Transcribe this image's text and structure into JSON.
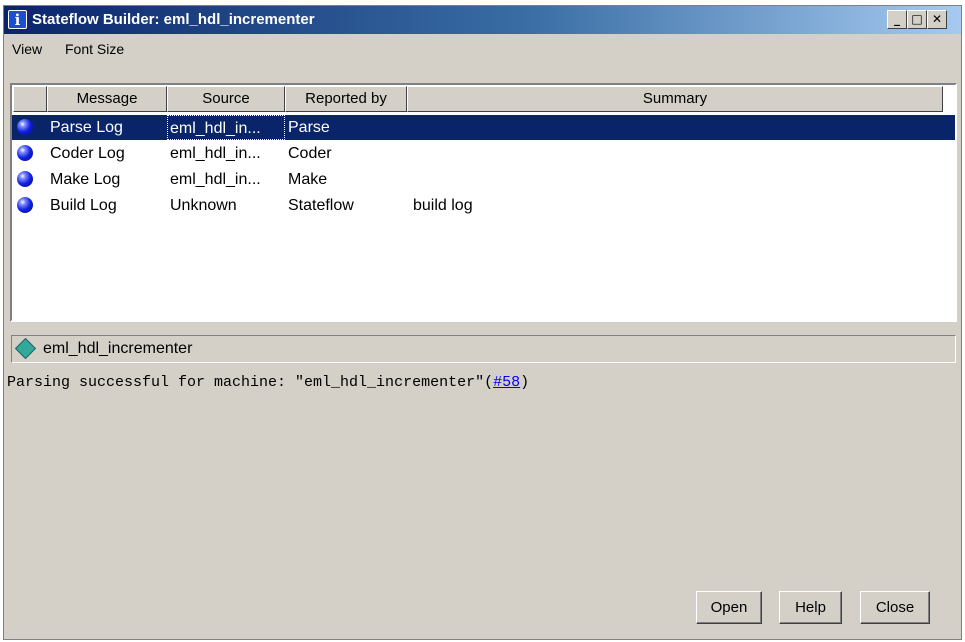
{
  "window": {
    "title": "Stateflow Builder: eml_hdl_incrementer",
    "controls": {
      "minimize": "_",
      "maximize": "□",
      "close": "✕"
    }
  },
  "menubar": {
    "items": [
      "View",
      "Font Size"
    ]
  },
  "grid": {
    "columns": [
      "Message",
      "Source",
      "Reported by",
      "Summary"
    ],
    "rows": [
      {
        "icon": "blue-ball-icon",
        "message": "Parse Log",
        "source": "eml_hdl_in...",
        "reported_by": "Parse",
        "summary": "",
        "selected": true
      },
      {
        "icon": "blue-ball-icon",
        "message": "Coder Log",
        "source": "eml_hdl_in...",
        "reported_by": "Coder",
        "summary": "",
        "selected": false
      },
      {
        "icon": "blue-ball-icon",
        "message": "Make Log",
        "source": "eml_hdl_in...",
        "reported_by": "Make",
        "summary": "",
        "selected": false
      },
      {
        "icon": "blue-ball-icon",
        "message": "Build Log",
        "source": "Unknown",
        "reported_by": "Stateflow",
        "summary": "build log",
        "selected": false
      }
    ]
  },
  "path_bar": {
    "icon": "stateflow-diamond-icon",
    "text": "eml_hdl_incrementer"
  },
  "log": {
    "prefix": "Parsing successful for machine: \"eml_hdl_incrementer\"(",
    "link": "#58",
    "suffix": ")"
  },
  "buttons": {
    "open": "Open",
    "help": "Help",
    "close": "Close"
  },
  "colors": {
    "selection": "#0a246a",
    "window_bg": "#d4d0c8",
    "link": "#0000ee"
  }
}
